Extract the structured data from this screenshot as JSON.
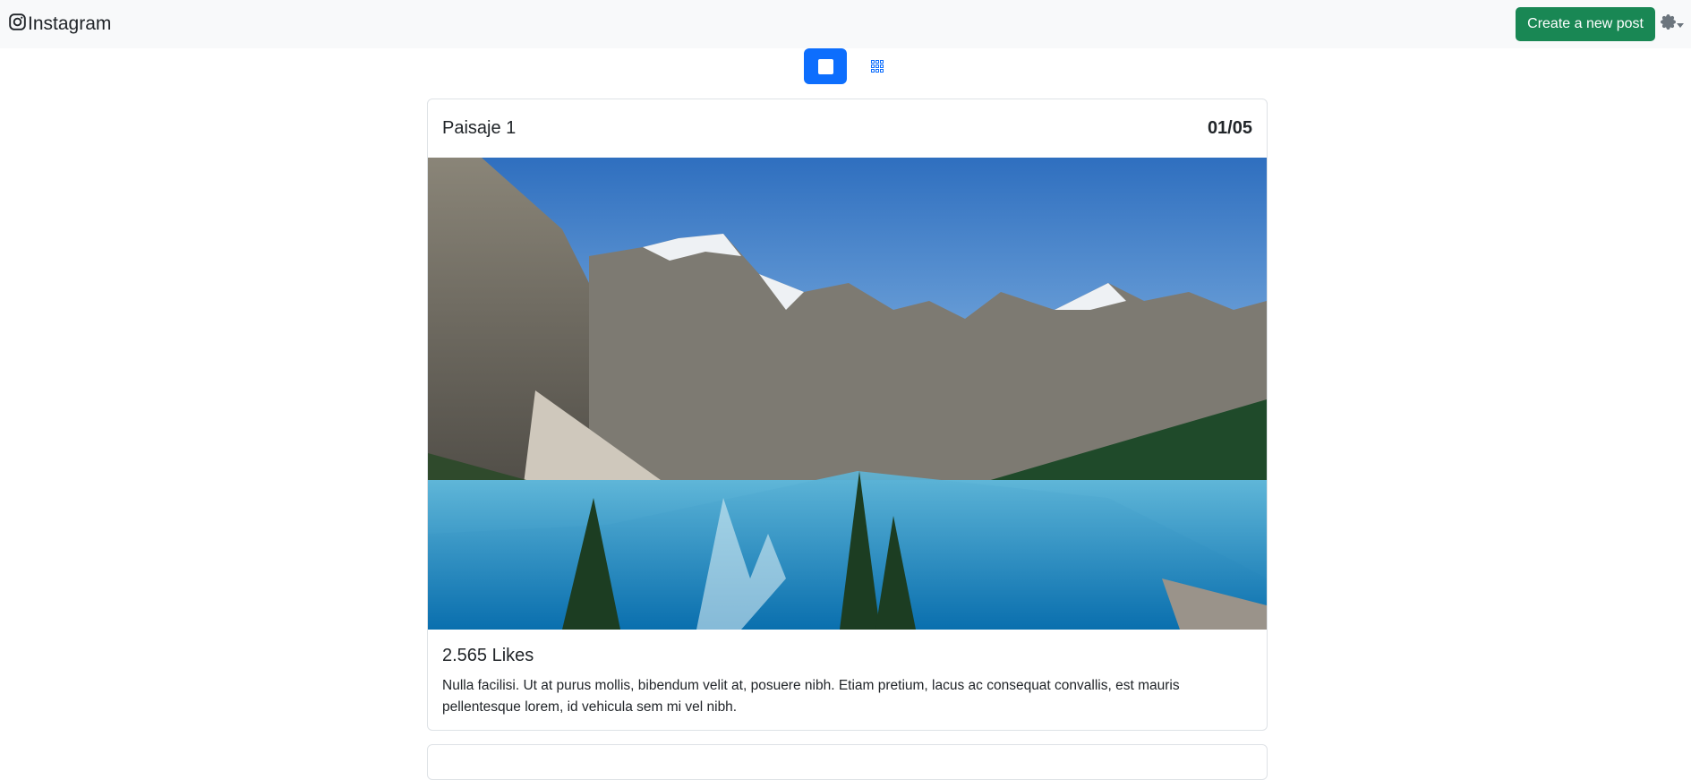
{
  "navbar": {
    "brand": "Instagram",
    "create_label": "Create a new post",
    "brand_icon": "instagram-icon",
    "settings_icon": "gear-icon"
  },
  "view_toggle": {
    "single_icon": "single-view-icon",
    "grid_icon": "grid-view-icon",
    "active": "single"
  },
  "post": {
    "title": "Paisaje 1",
    "counter": "01/05",
    "likes": "2.565 Likes",
    "caption": "Nulla facilisi. Ut at purus mollis, bibendum velit at, posuere nibh. Etiam pretium, lacus ac consequat convallis, est mauris pellentesque lorem, id vehicula sem mi vel nibh."
  },
  "colors": {
    "success": "#198754",
    "primary": "#0d6efd",
    "navbar_bg": "#f8f9fa"
  }
}
